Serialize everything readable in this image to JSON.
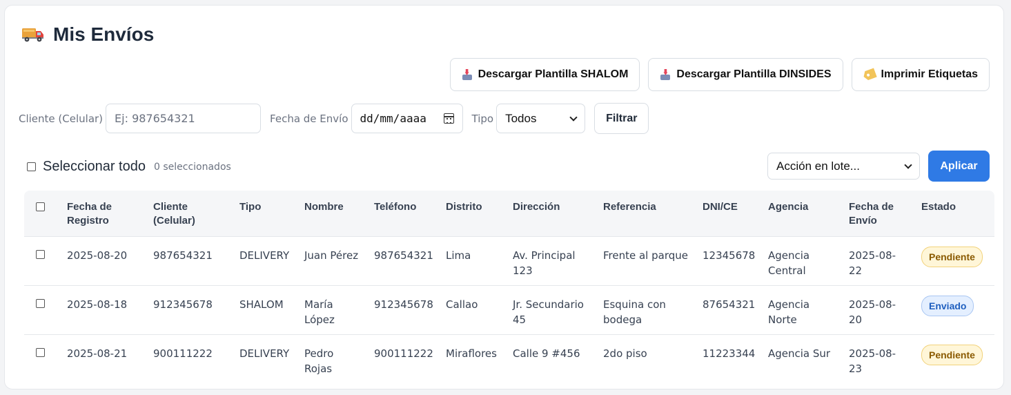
{
  "header": {
    "title": "Mis Envíos",
    "icon": "delivery-truck-icon"
  },
  "top_buttons": [
    {
      "label": "Descargar Plantilla SHALOM",
      "icon": "inbox-tray-icon"
    },
    {
      "label": "Descargar Plantilla DINSIDES",
      "icon": "inbox-tray-icon"
    },
    {
      "label": "Imprimir Etiquetas",
      "icon": "label-tag-icon"
    }
  ],
  "filters": {
    "client_label": "Cliente (Celular)",
    "client_placeholder": "Ej: 987654321",
    "date_label": "Fecha de Envío",
    "date_value": "dd/mm/aaaa",
    "type_label": "Tipo",
    "type_value": "Todos",
    "filter_button": "Filtrar"
  },
  "selection": {
    "select_all_label": "Seleccionar todo",
    "selected_count": "0 seleccionados",
    "batch_action_value": "Acción en lote...",
    "apply_button": "Aplicar"
  },
  "table": {
    "columns": [
      "Fecha de Registro",
      "Cliente (Celular)",
      "Tipo",
      "Nombre",
      "Teléfono",
      "Distrito",
      "Dirección",
      "Referencia",
      "DNI/CE",
      "Agencia",
      "Fecha de Envío",
      "Estado"
    ],
    "rows": [
      [
        "2025-08-20",
        "987654321",
        "DELIVERY",
        "Juan Pérez",
        "987654321",
        "Lima",
        "Av. Principal 123",
        "Frente al parque",
        "12345678",
        "Agencia Central",
        "2025-08-22",
        "Pendiente"
      ],
      [
        "2025-08-18",
        "912345678",
        "SHALOM",
        "María López",
        "912345678",
        "Callao",
        "Jr. Secundario 45",
        "Esquina con bodega",
        "87654321",
        "Agencia Norte",
        "2025-08-20",
        "Enviado"
      ],
      [
        "2025-08-21",
        "900111222",
        "DELIVERY",
        "Pedro Rojas",
        "900111222",
        "Miraflores",
        "Calle 9 #456",
        "2do piso",
        "11223344",
        "Agencia Sur",
        "2025-08-23",
        "Pendiente"
      ]
    ]
  },
  "colors": {
    "primary": "#2f7ae5",
    "pending_bg": "#fff6d8",
    "pending_text": "#8a5a00",
    "sent_bg": "#e4efff",
    "sent_text": "#1f5fbf"
  }
}
